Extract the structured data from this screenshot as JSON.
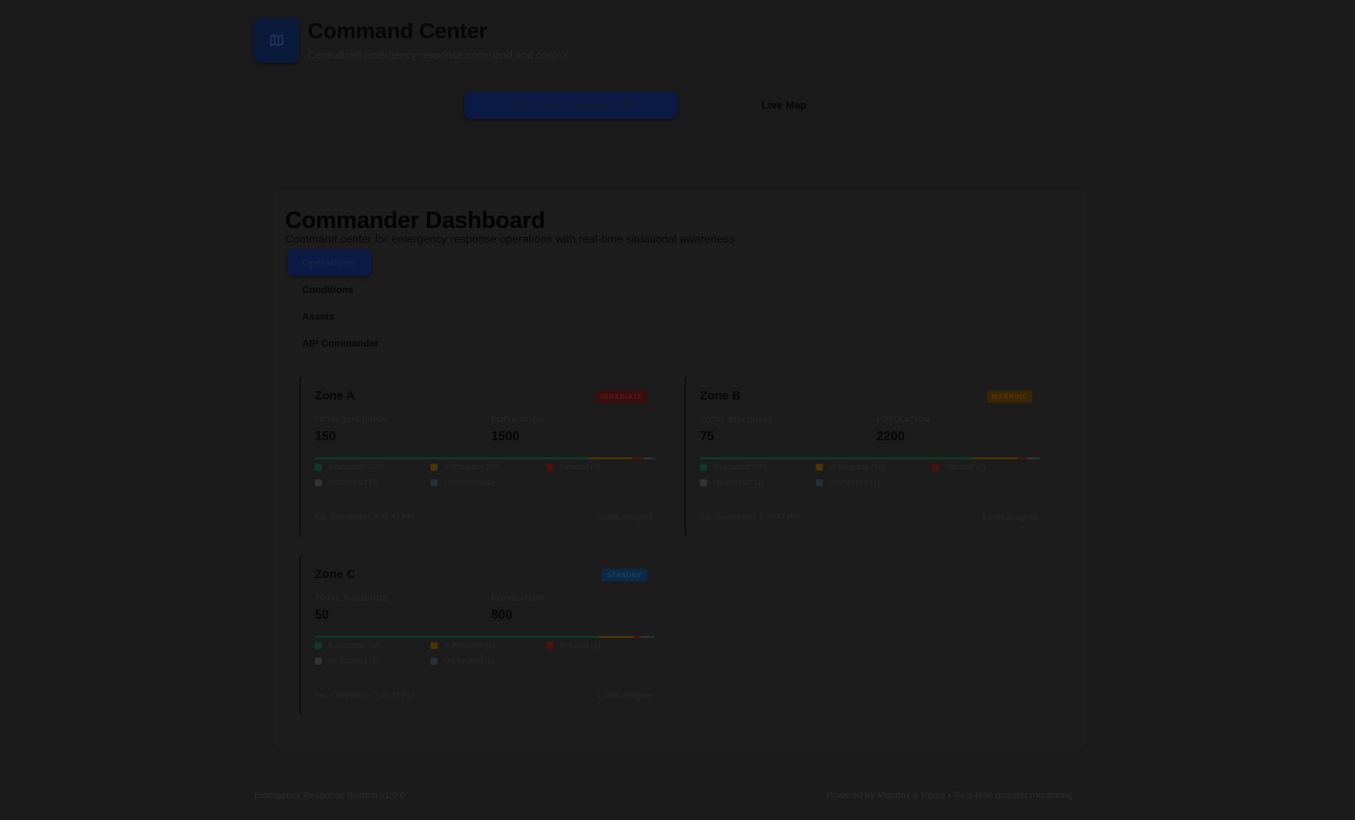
{
  "app": {
    "title": "Command Center",
    "subtitle": "Centralized emergency response command and control",
    "logo_icon": "map-icon",
    "accent": "#0b1a44"
  },
  "topnav": {
    "tabs": [
      {
        "label": "Commander Dashboard",
        "active": true
      },
      {
        "label": "Live Map",
        "active": false
      }
    ]
  },
  "dashboard": {
    "title": "Commander Dashboard",
    "subtitle": "Command center for emergency response operations with real-time situational awareness"
  },
  "subnav": {
    "items": [
      {
        "label": "Operations",
        "active": true
      },
      {
        "label": "Conditions",
        "active": false
      },
      {
        "label": "Assets",
        "active": false
      },
      {
        "label": "AIP Commander",
        "active": false
      }
    ]
  },
  "zones": [
    {
      "name": "Zone A",
      "badge": "IMMEDIATE",
      "badge_type": "immediate",
      "buildings_label": "TOTAL BUILDINGS",
      "buildings": "150",
      "population_label": "POPULATION",
      "population": "1500",
      "legend": [
        {
          "label": "Evacuated (120)",
          "count": 120,
          "color": "#0f3a2a"
        },
        {
          "label": "In Progress (20)",
          "count": 20,
          "color": "#4a3306"
        },
        {
          "label": "Refused (5)",
          "count": 5,
          "color": "#4a1212"
        },
        {
          "label": "No Contact (3)",
          "count": 3,
          "color": "#333333"
        },
        {
          "label": "Unchecked (2)",
          "count": 2,
          "color": "#25303a"
        }
      ],
      "completion": "Est. Completion: 8:39:47 PM",
      "units": "2 units assigned"
    },
    {
      "name": "Zone B",
      "badge": "WARNING",
      "badge_type": "warning",
      "buildings_label": "TOTAL BUILDINGS",
      "buildings": "75",
      "population_label": "POPULATION",
      "population": "2200",
      "legend": [
        {
          "label": "Evacuated (60)",
          "count": 60,
          "color": "#0f3a2a"
        },
        {
          "label": "In Progress (10)",
          "count": 10,
          "color": "#4a3306"
        },
        {
          "label": "Refused (2)",
          "count": 2,
          "color": "#4a1212"
        },
        {
          "label": "No Contact (2)",
          "count": 2,
          "color": "#333333"
        },
        {
          "label": "Unchecked (1)",
          "count": 1,
          "color": "#25303a"
        }
      ],
      "completion": "Est. Completion: 8:39:47 PM",
      "units": "1 units assigned"
    },
    {
      "name": "Zone C",
      "badge": "STANDBY",
      "badge_type": "standby",
      "buildings_label": "TOTAL BUILDINGS",
      "buildings": "50",
      "population_label": "POPULATION",
      "population": "800",
      "legend": [
        {
          "label": "Evacuated (40)",
          "count": 40,
          "color": "#0f3a2a"
        },
        {
          "label": "In Progress (5)",
          "count": 5,
          "color": "#4a3306"
        },
        {
          "label": "Refused (1)",
          "count": 1,
          "color": "#4a1212"
        },
        {
          "label": "No Contact (1)",
          "count": 1,
          "color": "#333333"
        },
        {
          "label": "Unchecked (1)",
          "count": 1,
          "color": "#25303a"
        }
      ],
      "completion": "Est. Completion: 7:39:47 PM",
      "units": "1 units assigned"
    }
  ],
  "footer": {
    "left": "Emergency Response System v1.0.0",
    "right": "Powered by Mapbox & React • Real-time disaster monitoring"
  }
}
